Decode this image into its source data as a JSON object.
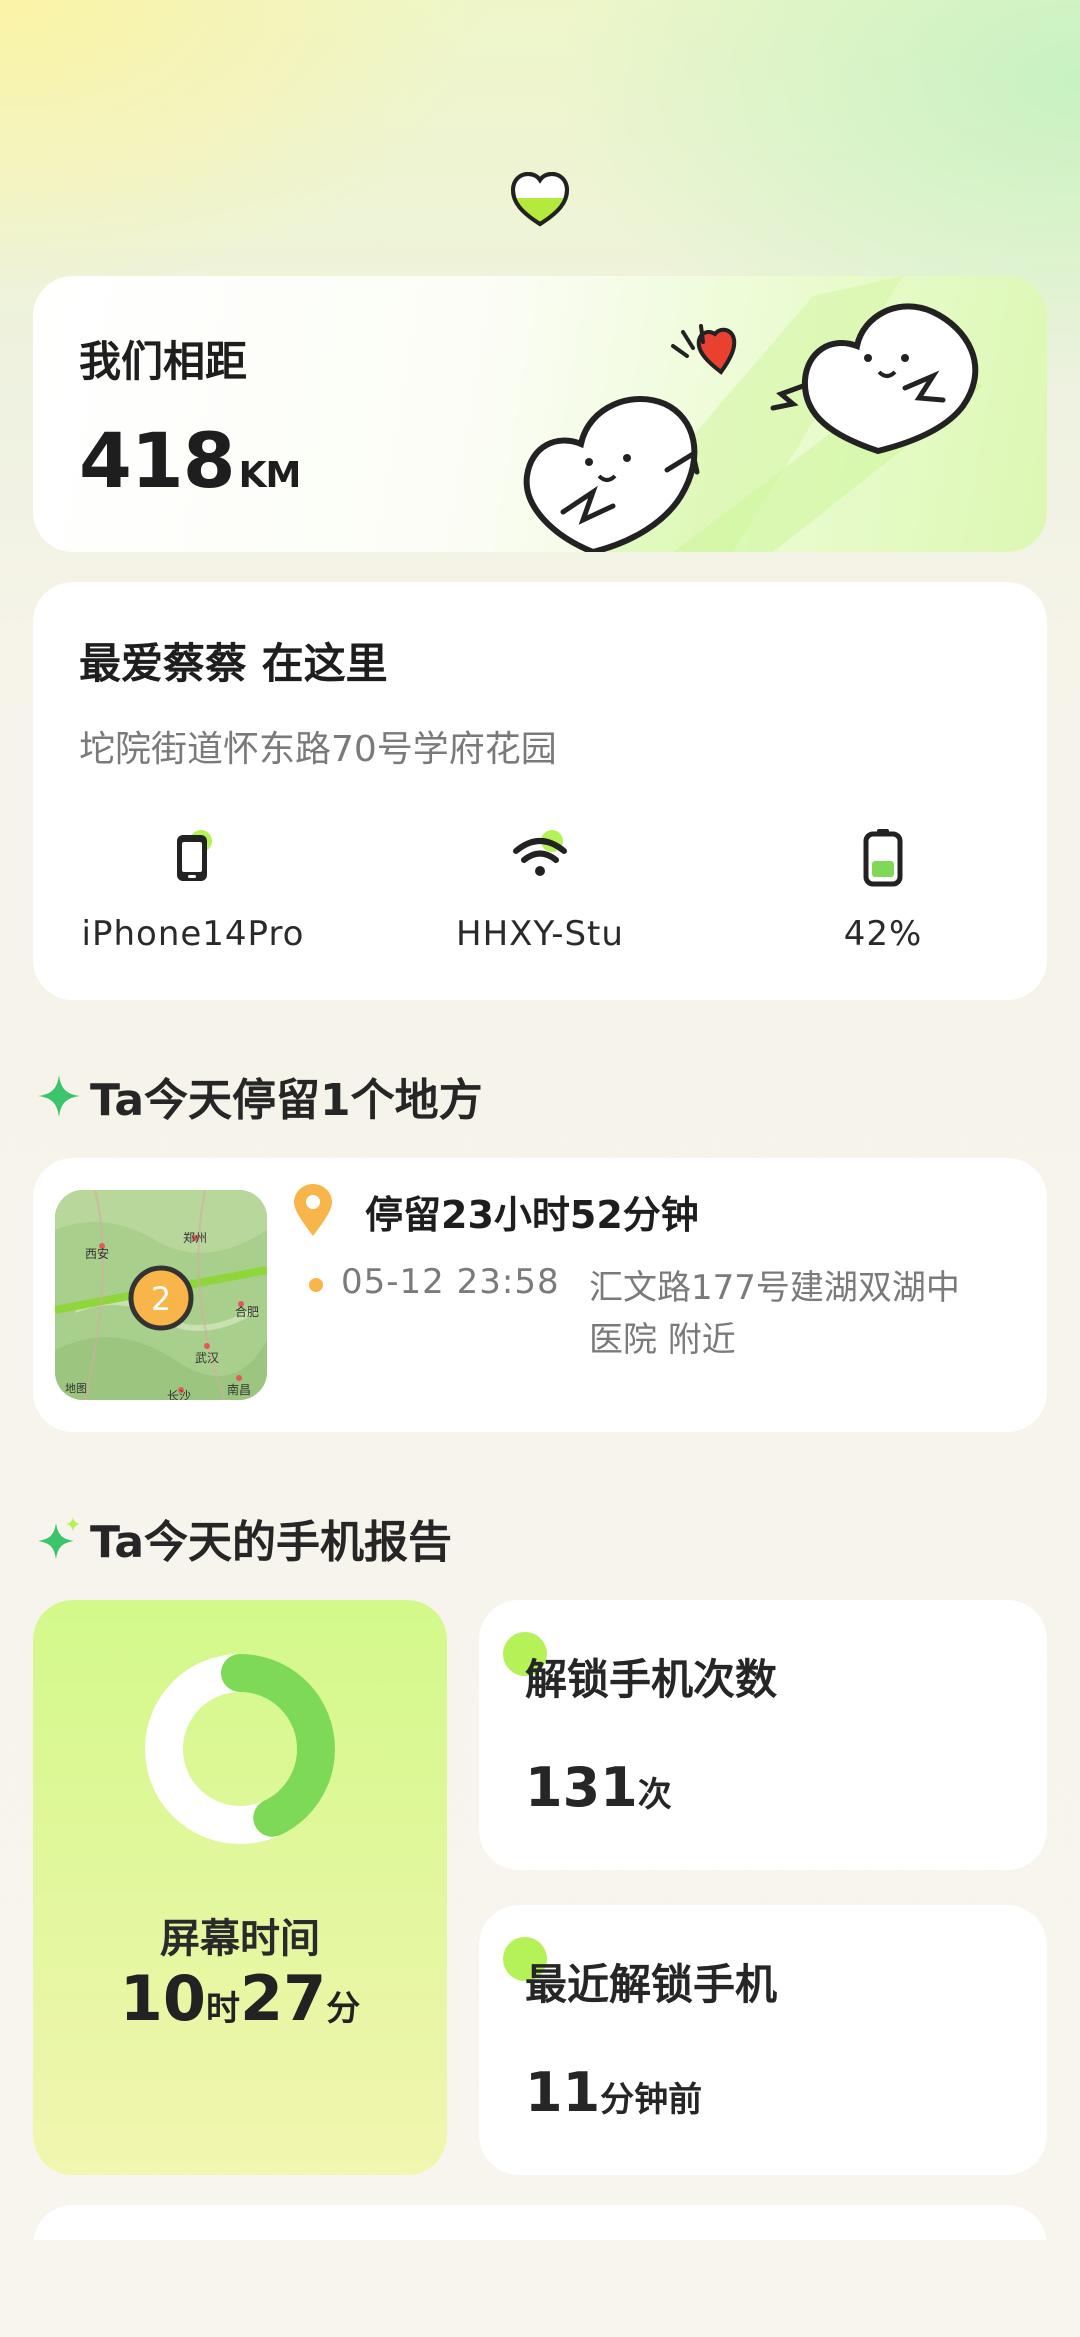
{
  "distance": {
    "title": "我们相距",
    "value": "418",
    "unit": "KM"
  },
  "location": {
    "title": "最爱蔡蔡 在这里",
    "address": "坨院街道怀东路70号学府花园",
    "device": "iPhone14Pro",
    "wifi": "HHXY-Stu",
    "battery": "42%",
    "battery_level": 0.42
  },
  "stay_section": {
    "heading": "Ta今天停留1个地方"
  },
  "stay": {
    "duration": "停留23小时52分钟",
    "time": "05-12 23:58",
    "address": "汇文路177号建湖双湖中医院 附近",
    "map_count": "2",
    "map_labels": {
      "xian": "西安",
      "zhengzhou": "郑州",
      "hefei": "合肥",
      "wuhan": "武汉",
      "changsha": "长沙",
      "nanchang": "南昌",
      "maps": "地图"
    }
  },
  "report_section": {
    "heading": "Ta今天的手机报告"
  },
  "screen_time": {
    "label": "屏幕时间",
    "hours": "10",
    "hours_unit": "时",
    "minutes": "27",
    "minutes_unit": "分",
    "ring_fraction": 0.43
  },
  "unlock_count": {
    "title": "解锁手机次数",
    "value": "131",
    "unit": "次"
  },
  "last_unlock": {
    "title": "最近解锁手机",
    "value": "11",
    "unit": "分钟前"
  },
  "colors": {
    "accent_green": "#7ed957",
    "light_green": "#b4f258",
    "pin_orange": "#f7b54a",
    "heart_red": "#e8412f"
  }
}
